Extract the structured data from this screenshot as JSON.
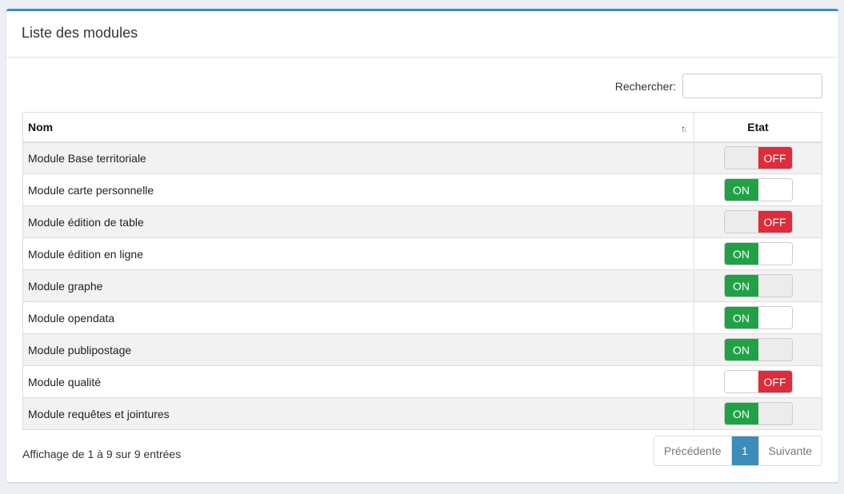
{
  "box": {
    "title": "Liste des modules"
  },
  "search": {
    "label": "Rechercher:",
    "value": "",
    "placeholder": ""
  },
  "table": {
    "columns": [
      "Nom",
      "Etat"
    ],
    "rows": [
      {
        "name": "Module Base territoriale",
        "state": "OFF"
      },
      {
        "name": "Module carte personnelle",
        "state": "ON"
      },
      {
        "name": "Module édition de table",
        "state": "OFF"
      },
      {
        "name": "Module édition en ligne",
        "state": "ON"
      },
      {
        "name": "Module graphe",
        "state": "ON"
      },
      {
        "name": "Module opendata",
        "state": "ON"
      },
      {
        "name": "Module publipostage",
        "state": "ON"
      },
      {
        "name": "Module qualité",
        "state": "OFF"
      },
      {
        "name": "Module requêtes et jointures",
        "state": "ON"
      }
    ],
    "toggle_labels": {
      "on": "ON",
      "off": "OFF"
    },
    "sort_icon": "sort-ascending-icon"
  },
  "footer": {
    "info": "Affichage de 1 à 9 sur 9 entrées"
  },
  "pagination": {
    "previous": "Précédente",
    "current": "1",
    "next": "Suivante"
  },
  "colors": {
    "accent": "#3c8dbc",
    "on": "#20a145",
    "off": "#dd2c3a"
  }
}
